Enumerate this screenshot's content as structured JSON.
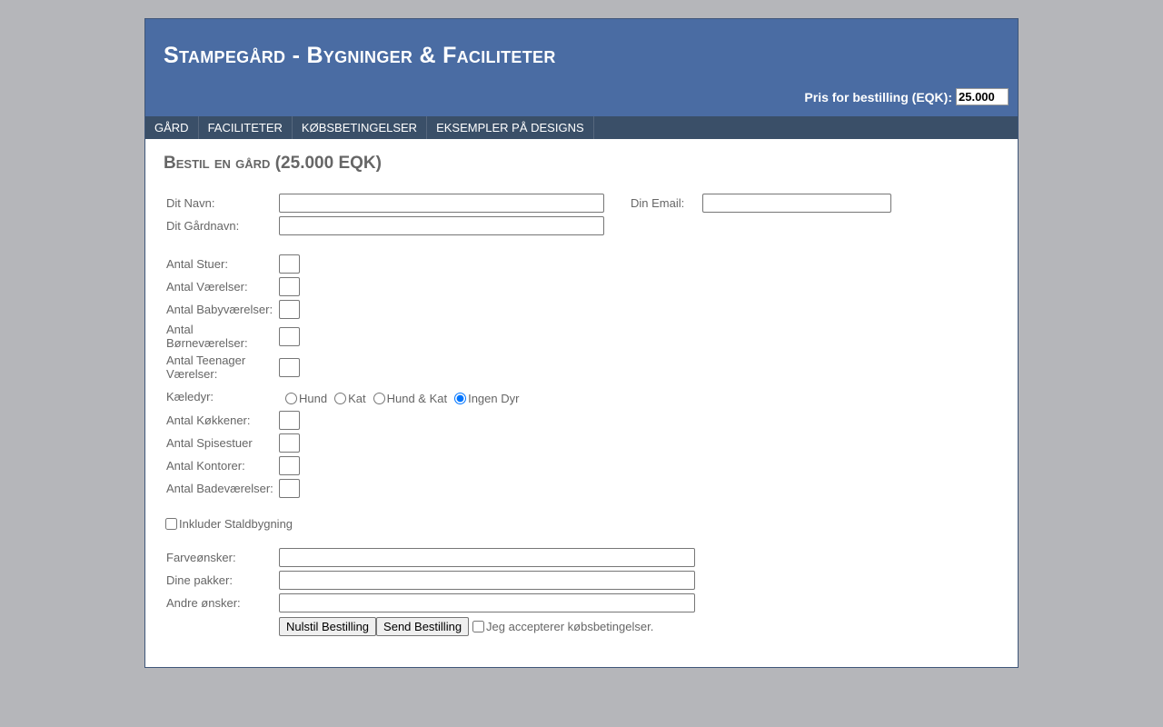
{
  "header": {
    "title": "Stampegård - Bygninger & Faciliteter",
    "price_label": "Pris for bestilling (EQK):",
    "price_value": "25.000"
  },
  "nav": {
    "items": [
      {
        "label": "Gård"
      },
      {
        "label": "Faciliteter"
      },
      {
        "label": "Købsbetingelser"
      },
      {
        "label": "Eksempler på designs"
      }
    ]
  },
  "form": {
    "title": "Bestil en gård (25.000 EQK)",
    "name_label": "Dit Navn:",
    "name_value": "",
    "email_label": "Din Email:",
    "email_value": "",
    "farm_name_label": "Dit Gårdnavn:",
    "farm_name_value": "",
    "rooms": {
      "stuer_label": "Antal Stuer:",
      "vaerelser_label": "Antal Værelser:",
      "babyvaerelser_label": "Antal Babyværelser:",
      "boernevaerelser_label": "Antal Børneværelser:",
      "teenager_label": "Antal Teenager Værelser:"
    },
    "pets": {
      "label": "Kæledyr:",
      "options": [
        "Hund",
        "Kat",
        "Hund & Kat",
        "Ingen Dyr"
      ],
      "selected": "Ingen Dyr"
    },
    "rooms2": {
      "koekkener_label": "Antal Køkkener:",
      "spisestuer_label": "Antal Spisestuer",
      "kontorer_label": "Antal Kontorer:",
      "badevaerelser_label": "Antal Badeværelser:"
    },
    "stable_label": "Inkluder Staldbygning",
    "stable_checked": false,
    "color_label": "Farveønsker:",
    "color_value": "",
    "packages_label": "Dine pakker:",
    "packages_value": "",
    "other_label": "Andre ønsker:",
    "other_value": "",
    "reset_label": "Nulstil Bestilling",
    "submit_label": "Send Bestilling",
    "accept_label": "Jeg accepterer købsbetingelser.",
    "accept_checked": false
  }
}
